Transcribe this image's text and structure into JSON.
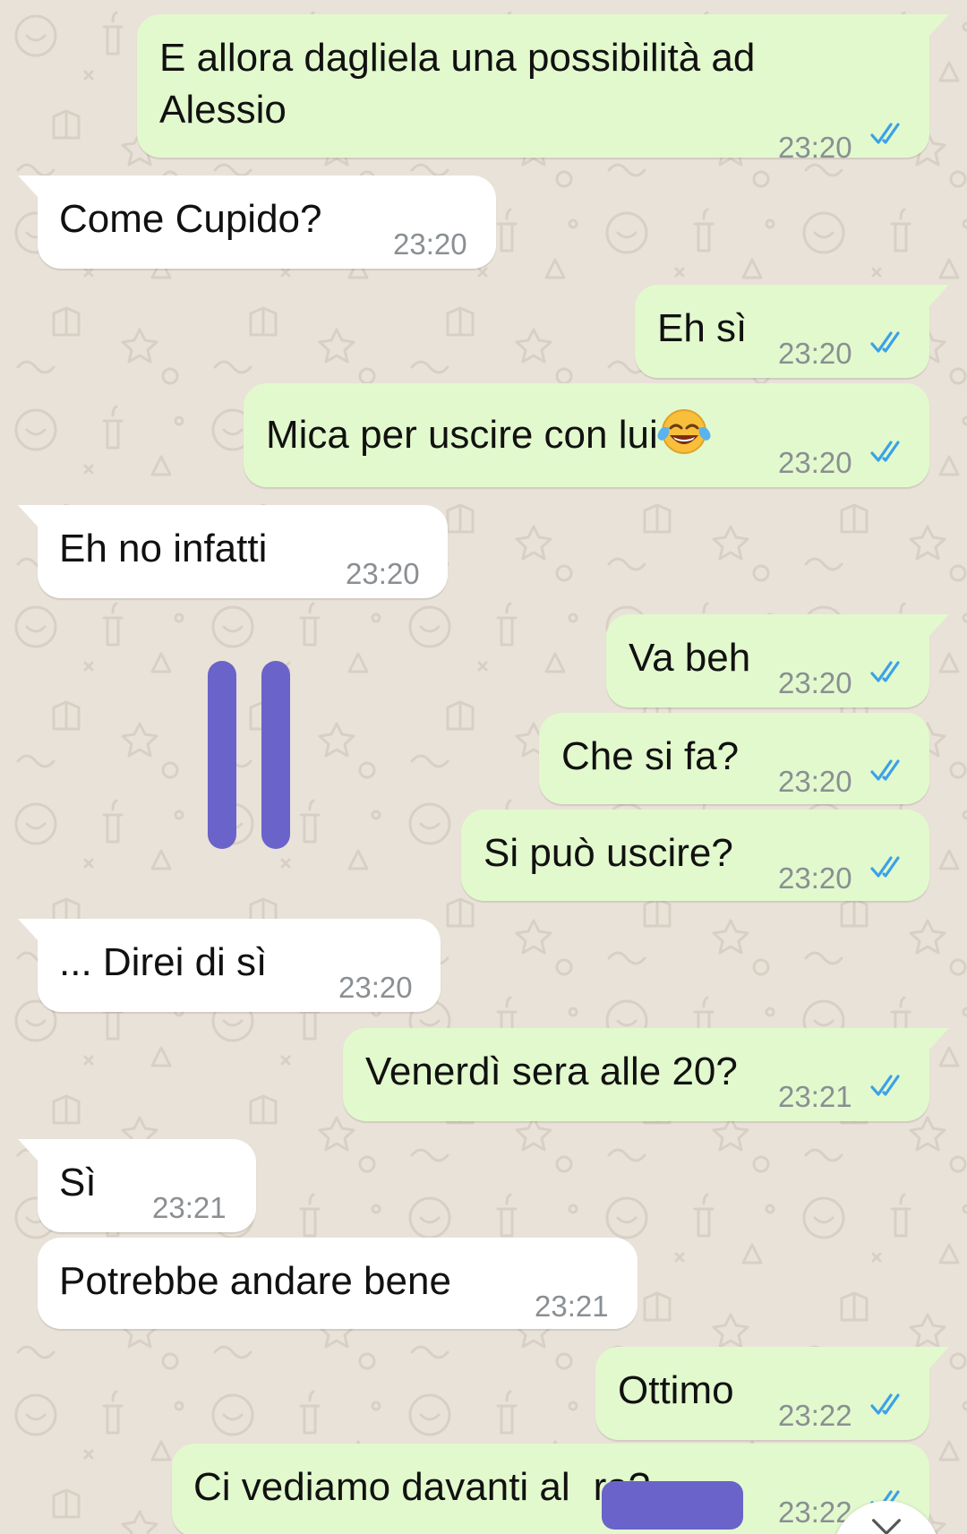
{
  "chat": {
    "theme": {
      "outgoing_bubble": "#e2f9cd",
      "incoming_bubble": "#ffffff",
      "read_ticks": "#3ba1e8",
      "timestamp": "#8a8f93",
      "redaction_mark": "#6a63c9"
    },
    "messages": [
      {
        "dir": "out",
        "text": "E allora dagliela una possibilità ad Alessio",
        "time": "23:20",
        "status": "read"
      },
      {
        "dir": "in",
        "text": "Come Cupido?",
        "time": "23:20"
      },
      {
        "dir": "out",
        "text": "Eh sì",
        "time": "23:20",
        "status": "read"
      },
      {
        "dir": "out",
        "text": "Mica per uscire con lui",
        "emoji": "face-with-tears-of-joy-icon",
        "time": "23:20",
        "status": "read"
      },
      {
        "dir": "in",
        "text": "Eh no infatti",
        "time": "23:20"
      },
      {
        "dir": "out",
        "text": "Va beh",
        "time": "23:20",
        "status": "read"
      },
      {
        "dir": "out",
        "text": "Che si fa?",
        "time": "23:20",
        "status": "read"
      },
      {
        "dir": "out",
        "text": "Si può uscire?",
        "time": "23:20",
        "status": "read"
      },
      {
        "dir": "in",
        "text": "... Direi di sì",
        "time": "23:20"
      },
      {
        "dir": "out",
        "text": "Venerdì sera alle 20?",
        "time": "23:21",
        "status": "read"
      },
      {
        "dir": "in",
        "text": "Sì",
        "time": "23:21"
      },
      {
        "dir": "in",
        "text": "Potrebbe andare bene",
        "time": "23:21"
      },
      {
        "dir": "out",
        "text": "Ottimo",
        "time": "23:22",
        "status": "read"
      },
      {
        "dir": "out",
        "text": "Ci vediamo davanti al",
        "text_after": "ra?",
        "redacted": true,
        "time": "23:22",
        "status": "read"
      }
    ],
    "annotation_icon": "pause-bars-icon",
    "scroll_button_icon": "chevron-down-icon"
  }
}
